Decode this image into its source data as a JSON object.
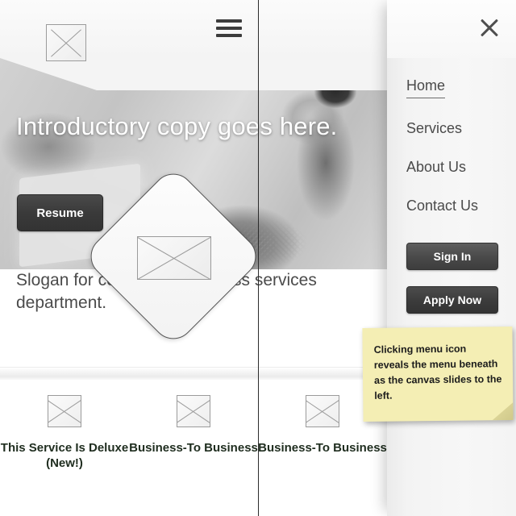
{
  "header": {
    "logo_icon": "image-placeholder-icon",
    "menu_icon": "hamburger-menu-icon"
  },
  "hero": {
    "title": "Introductory copy goes here.",
    "cta_label": "Resume",
    "image_alt": "grayscale-photo-person-holding-device"
  },
  "feature": {
    "diamond_icon": "image-placeholder-icon"
  },
  "slogan": {
    "text": "Slogan for company's business services department."
  },
  "services": [
    {
      "icon": "image-placeholder-icon",
      "label": "This Service Is Deluxe (New!)"
    },
    {
      "icon": "image-placeholder-icon",
      "label": "Business-To Business"
    },
    {
      "icon": "image-placeholder-icon",
      "label": "Business-To Business"
    }
  ],
  "menu": {
    "close_icon": "close-x-icon",
    "items": [
      {
        "label": "Home",
        "active": true
      },
      {
        "label": "Services",
        "active": false
      },
      {
        "label": "About Us",
        "active": false
      },
      {
        "label": "Contact Us",
        "active": false
      }
    ],
    "sign_in_label": "Sign In",
    "apply_now_label": "Apply Now"
  },
  "annotation": {
    "note_text": "Clicking menu icon reveals the menu beneath as the canvas slides to the left."
  },
  "colors": {
    "note_bg": "#f4eeb4",
    "button_dark": "#3d3d3d",
    "service_label": "#1f2d1f",
    "menu_bg": "#f5f5f5"
  }
}
